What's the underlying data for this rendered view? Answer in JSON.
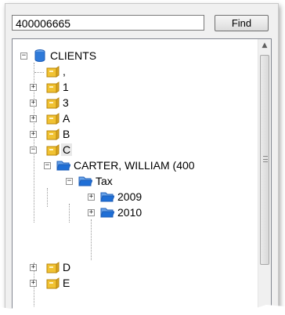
{
  "search": {
    "value": "400006665",
    "find_label": "Find"
  },
  "tree": {
    "root": {
      "label": "CLIENTS",
      "expander": "−"
    },
    "items": [
      {
        "label": ",",
        "expander": ""
      },
      {
        "label": "1",
        "expander": "+"
      },
      {
        "label": "3",
        "expander": "+"
      },
      {
        "label": "A",
        "expander": "+"
      },
      {
        "label": "B",
        "expander": "+"
      },
      {
        "label": "C",
        "expander": "−"
      },
      {
        "label": "CARTER, WILLIAM (400",
        "expander": "−"
      },
      {
        "label": "Tax",
        "expander": "−"
      },
      {
        "label": "2009",
        "expander": "+"
      },
      {
        "label": "2010",
        "expander": "+"
      },
      {
        "label": "D",
        "expander": "+"
      },
      {
        "label": "E",
        "expander": "+"
      }
    ]
  },
  "colors": {
    "accent_blue": "#1f6fd6",
    "folder_yellow": "#f1c232",
    "selection": "#e8e8e8"
  }
}
